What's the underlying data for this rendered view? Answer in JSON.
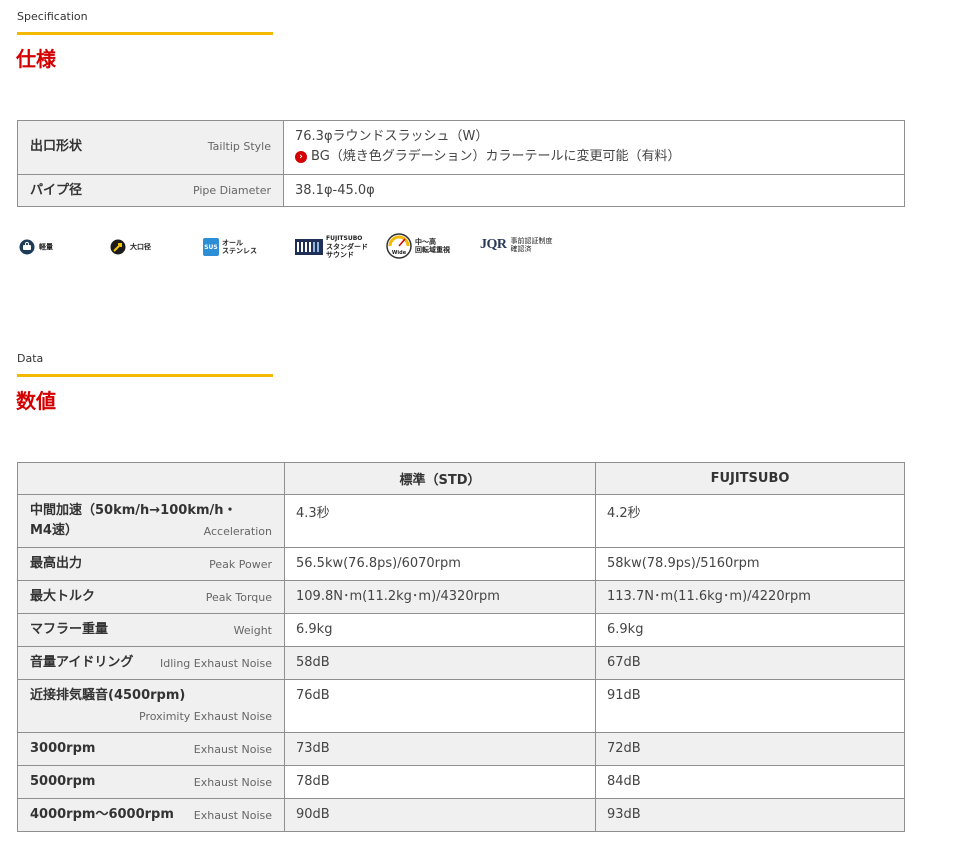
{
  "spec_section": {
    "subtitle": "Specification",
    "title": "仕様",
    "rows": [
      {
        "label": "出口形状",
        "label_en": "Tailtip Style",
        "value_line1": "76.3φラウンドスラッシュ（W）",
        "value_line2": "BG（焼き色グラデーション）カラーテールに変更可能（有料）"
      },
      {
        "label": "パイプ径",
        "label_en": "Pipe Diameter",
        "value_line1": "38.1φ-45.0φ"
      }
    ]
  },
  "feature_icons": [
    {
      "icon": "lightweight-icon",
      "label": "軽量"
    },
    {
      "icon": "large-bore-icon",
      "label": "大口径"
    },
    {
      "icon": "sus-stainless-icon",
      "badge": "SUS",
      "label1": "オール",
      "label2": "ステンレス"
    },
    {
      "icon": "standard-sound-icon",
      "brand": "FUJITSUBO",
      "label1": "スタンダード",
      "label2": "サウンド"
    },
    {
      "icon": "mid-range-torque-icon",
      "badge": "Wide",
      "label1": "中～高",
      "label2": "回転域重視"
    },
    {
      "icon": "jqr-icon",
      "badge": "JQR",
      "label1": "事前認証制度",
      "label2": "確認済"
    }
  ],
  "data_section": {
    "subtitle": "Data",
    "title": "数値",
    "columns": [
      "",
      "標準（STD）",
      "FUJITSUBO"
    ],
    "rows": [
      {
        "label": "中間加速（50km/h→100km/h・M4速）",
        "label_line1": "中間加速（50km/h→100km/h・",
        "label_line2": "M4速）",
        "label_en": "Acceleration",
        "std": "4.3秒",
        "fujitsubo": "4.2秒"
      },
      {
        "label": "最高出力",
        "label_en": "Peak Power",
        "std": "56.5kw(76.8ps)/6070rpm",
        "fujitsubo": "58kw(78.9ps)/5160rpm"
      },
      {
        "label": "最大トルク",
        "label_en": "Peak Torque",
        "std": "109.8N･m(11.2kg･m)/4320rpm",
        "fujitsubo": "113.7N･m(11.6kg･m)/4220rpm"
      },
      {
        "label": "マフラー重量",
        "label_en": "Weight",
        "std": "6.9kg",
        "fujitsubo": "6.9kg"
      },
      {
        "label": "音量アイドリング",
        "label_en": "Idling Exhaust Noise",
        "std": "58dB",
        "fujitsubo": "67dB"
      },
      {
        "label": "近接排気騒音(4500rpm)",
        "label_en": "Proximity Exhaust Noise",
        "std": "76dB",
        "fujitsubo": "91dB"
      },
      {
        "label": "3000rpm",
        "label_en": "Exhaust Noise",
        "std": "73dB",
        "fujitsubo": "72dB"
      },
      {
        "label": "5000rpm",
        "label_en": "Exhaust Noise",
        "std": "78dB",
        "fujitsubo": "84dB"
      },
      {
        "label": "4000rpm～6000rpm",
        "label_en": "Exhaust Noise",
        "std": "90dB",
        "fujitsubo": "93dB"
      }
    ]
  },
  "colors": {
    "accent_red": "#d40000",
    "accent_yellow": "#f5b800",
    "header_gray": "#f0f0f0",
    "border": "#8f8f8f"
  }
}
